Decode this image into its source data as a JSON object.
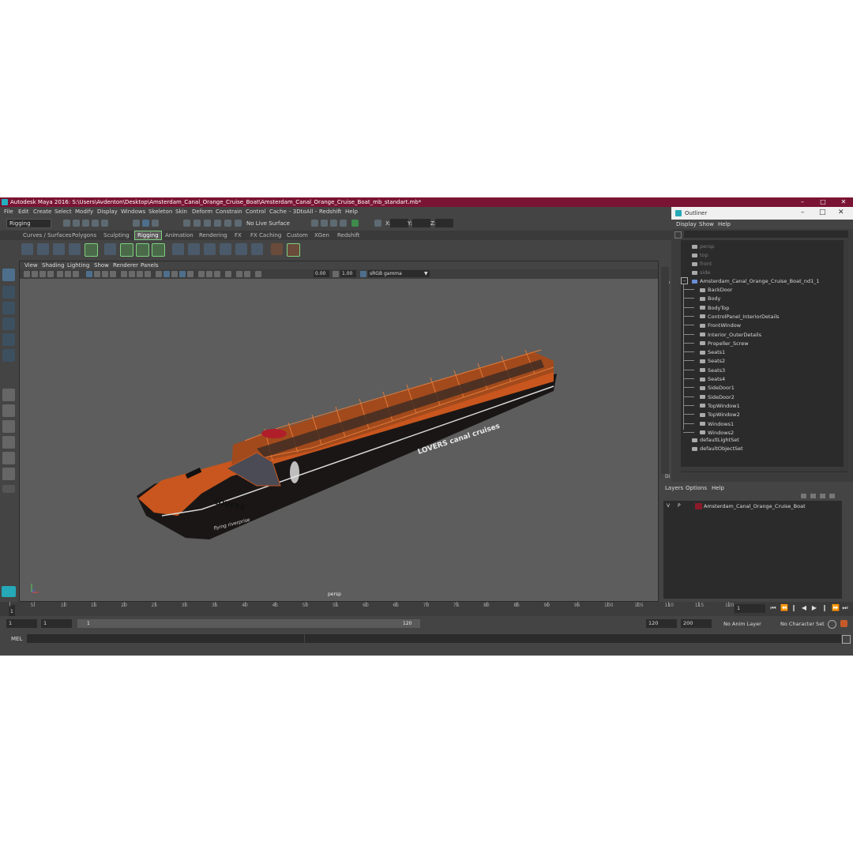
{
  "window": {
    "title": "Autodesk Maya 2016: S:\\Users\\Avdenton\\Desktop\\Amsterdam_Canal_Orange_Cruise_Boat\\Amsterdam_Canal_Orange_Cruise_Boat_mb_standart.mb*"
  },
  "menubar": [
    "File",
    "Edit",
    "Create",
    "Select",
    "Modify",
    "Display",
    "Windows",
    "Skeleton",
    "Skin",
    "Deform",
    "Constrain",
    "Control",
    "Cache",
    "- 3DtoAll -",
    "Redshift",
    "Help"
  ],
  "status": {
    "mode": "Rigging",
    "live_surface": "No Live Surface",
    "x_label": "X:",
    "y_label": "Y:",
    "z_label": "Z:"
  },
  "shelf_tabs": [
    "Curves / Surfaces",
    "Polygons",
    "Sculpting",
    "Rigging",
    "Animation",
    "Rendering",
    "FX",
    "FX Caching",
    "Custom",
    "XGen",
    "Redshift"
  ],
  "shelf_active": "Rigging",
  "viewport": {
    "menu": [
      "View",
      "Shading",
      "Lighting",
      "Show",
      "Renderer",
      "Panels"
    ],
    "exposure": "0.00",
    "gamma": "1.00",
    "colorspace": "sRGB gamma",
    "camera_label": "persp"
  },
  "boat": {
    "brand": "LOVERS",
    "side_text": "LOVERS canal cruises",
    "tagline": "flying riverprise",
    "colors": {
      "hull": "#1a1616",
      "orange": "#c8561e",
      "trim": "#d8d8d8"
    }
  },
  "outliner": {
    "title": "Outliner",
    "menu": [
      "Display",
      "Show",
      "Help"
    ],
    "cameras": [
      "persp",
      "top",
      "front",
      "side"
    ],
    "root": "Amsterdam_Canal_Orange_Cruise_Boat_nd1_1",
    "children": [
      "BackDoor",
      "Body",
      "BodyTop",
      "ControlPanel_InteriorDetails",
      "FrontWindow",
      "Interior_OuterDetails",
      "Propeller_Screw",
      "Seats1",
      "Seats2",
      "Seats3",
      "Seats4",
      "SideDoor1",
      "SideDoor2",
      "TopWindow1",
      "TopWindow2",
      "Windows1",
      "Windows2"
    ],
    "sets": [
      "defaultLightSet",
      "defaultObjectSet"
    ],
    "side_tabs": [
      "Ch",
      "Di"
    ]
  },
  "layers": {
    "menu": [
      "Layers",
      "Options",
      "Help"
    ],
    "rows": [
      {
        "v": "V",
        "p": "P",
        "name": "Amsterdam_Canal_Orange_Cruise_Boat",
        "color": "#8a1a2a"
      }
    ]
  },
  "timeline": {
    "ticks": [
      "1",
      "5",
      "10",
      "15",
      "20",
      "25",
      "30",
      "35",
      "40",
      "45",
      "50",
      "55",
      "60",
      "65",
      "70",
      "75",
      "80",
      "85",
      "90",
      "95",
      "100",
      "105",
      "110",
      "115",
      "120"
    ],
    "current_frame": "1",
    "current_frame_marker": "1"
  },
  "range": {
    "start": "1",
    "start2": "1",
    "slider_start": "1",
    "slider_end": "120",
    "end": "120",
    "max": "200",
    "anim_layer": "No Anim Layer",
    "character_set": "No Character Set"
  },
  "cmd": {
    "label": "MEL"
  }
}
